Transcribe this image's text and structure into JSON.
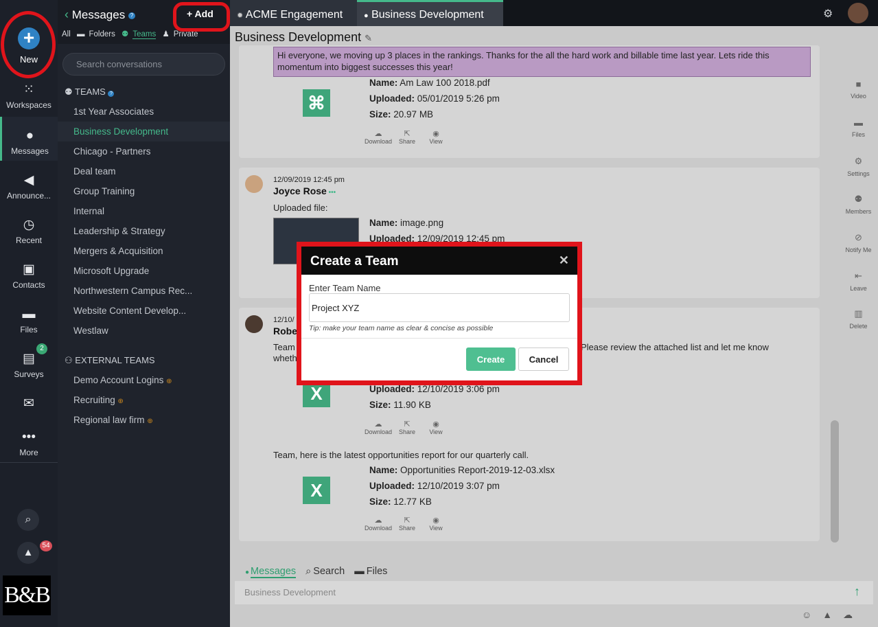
{
  "rail": {
    "new_label": "New",
    "items": [
      {
        "label": "Workspaces",
        "icon": "grid-icon"
      },
      {
        "label": "Messages",
        "icon": "chat-icon"
      },
      {
        "label": "Announce...",
        "icon": "megaphone-icon"
      },
      {
        "label": "Recent",
        "icon": "clock-icon"
      },
      {
        "label": "Contacts",
        "icon": "contacts-icon"
      },
      {
        "label": "Files",
        "icon": "folder-icon"
      },
      {
        "label": "Surveys",
        "icon": "clipboard-icon"
      },
      {
        "label": "More",
        "icon": "more-icon"
      }
    ],
    "surveys_badge": "2",
    "alerts_badge": "54",
    "logo_text": "B&B"
  },
  "sidebar": {
    "title": "Messages",
    "add_label": "+ Add",
    "filters": [
      "All",
      "Folders",
      "Teams",
      "Private"
    ],
    "search_placeholder": "Search conversations",
    "teams_heading": "TEAMS",
    "teams": [
      "1st Year Associates",
      "Business Development",
      "Chicago - Partners",
      "Deal team",
      "Group Training",
      "Internal",
      "Leadership & Strategy",
      "Mergers & Acquisition",
      "Microsoft Upgrade",
      "Northwestern Campus Rec...",
      "Website Content Develop...",
      "Westlaw"
    ],
    "external_heading": "EXTERNAL TEAMS",
    "external_teams": [
      "Demo Account Logins",
      "Recruiting",
      "Regional law firm"
    ]
  },
  "tabs": [
    "ACME Engagement",
    "Business Development"
  ],
  "conversation": {
    "title": "Business Development",
    "pinned_message": "Hi everyone, we moving up 3 places in the rankings.  Thanks for the all the hard work and billable time last year.  Lets ride this momentum into biggest successes this year!",
    "labels": {
      "name": "Name:",
      "uploaded": "Uploaded:",
      "size": "Size:"
    },
    "actions": [
      "Download",
      "Share",
      "View"
    ],
    "file1": {
      "name": "Am Law 100 2018.pdf",
      "uploaded": "05/01/2019 5:26 pm",
      "size": "20.97 MB"
    },
    "msg2": {
      "timestamp": "12/09/2019 12:45 pm",
      "user": "Joyce Rose",
      "text": "Uploaded file:",
      "file_name": "image.png",
      "file_uploaded": "12/09/2019 12:45 pm"
    },
    "msg3": {
      "timestamp_partial": "12/10/",
      "user_partial": "Robe",
      "text_a": "Team",
      "text_b": "Please review the attached list and let me know",
      "text_c": "wheth"
    },
    "file3": {
      "uploaded": "12/10/2019 3:06 pm",
      "size": "11.90 KB"
    },
    "msg4_text": "Team, here is the latest opportunities report for our quarterly call.",
    "file4": {
      "name": "Opportunities Report-2019-12-03.xlsx",
      "uploaded": "12/10/2019 3:07 pm",
      "size": "12.77 KB"
    }
  },
  "right_panel": [
    "Video",
    "Files",
    "Settings",
    "Members",
    "Notify Me",
    "Leave",
    "Delete"
  ],
  "compose": {
    "tabs": [
      "Messages",
      "Search",
      "Files"
    ],
    "placeholder": "Business Development"
  },
  "modal": {
    "title": "Create a Team",
    "field_label": "Enter Team Name",
    "field_value": "Project XYZ",
    "tip": "Tip: make your team name as clear & concise as possible",
    "create_label": "Create",
    "cancel_label": "Cancel"
  },
  "colors": {
    "accent": "#45b98b",
    "highlight": "#e0141b",
    "brand_blue": "#2f82c4"
  }
}
